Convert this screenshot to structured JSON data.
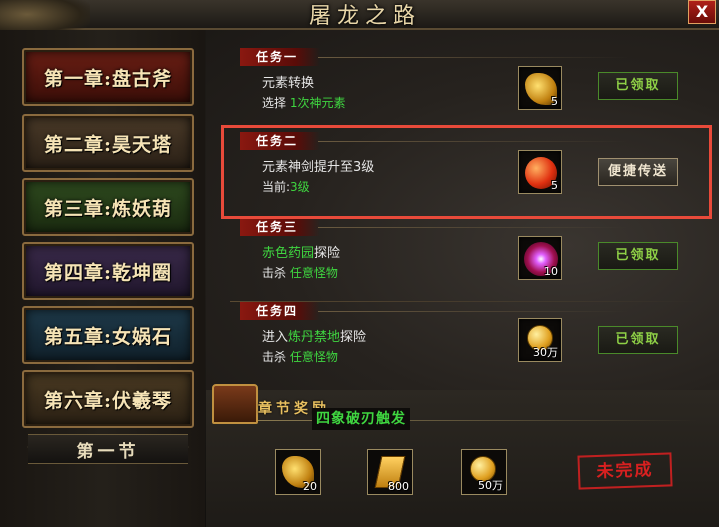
{
  "window": {
    "title": "屠龙之路",
    "close_label": "X"
  },
  "chapters": [
    {
      "label": "第一章:盘古斧"
    },
    {
      "label": "第二章:昊天塔"
    },
    {
      "label": "第三章:炼妖葫"
    },
    {
      "label": "第四章:乾坤圈"
    },
    {
      "label": "第五章:女娲石"
    },
    {
      "label": "第六章:伏羲琴"
    }
  ],
  "section_label": "第一节",
  "tasks": [
    {
      "tag": "任务一",
      "desc_pre": "元素转换",
      "desc_hl": "",
      "desc_post": "",
      "sub_label": "选择",
      "sub_value": "1次神元素",
      "reward_count": "5",
      "reward_icon": "gold-dragon-item-icon",
      "button": "已领取"
    },
    {
      "tag": "任务二",
      "desc_pre": "元素神剑提升至3级",
      "desc_hl": "",
      "desc_post": "",
      "sub_label": "当前:",
      "sub_value": "3级",
      "reward_count": "5",
      "reward_icon": "red-orb-item-icon",
      "button": "便捷传送"
    },
    {
      "tag": "任务三",
      "desc_pre": "",
      "desc_hl": "赤色药园",
      "desc_post": "探险",
      "sub_label": "击杀",
      "sub_value": "任意怪物",
      "reward_count": "10",
      "reward_icon": "purple-gem-item-icon",
      "button": "已领取"
    },
    {
      "tag": "任务四",
      "desc_pre": "进入",
      "desc_hl": "炼丹禁地",
      "desc_post": "探险",
      "sub_label": "击杀",
      "sub_value": "任意怪物",
      "reward_count": "30万",
      "reward_icon": "gold-coin-icon",
      "button": "已领取"
    }
  ],
  "chapter_reward": {
    "title": "章节奖励",
    "item_name": "四象破刃触发",
    "items": [
      {
        "count": "20",
        "icon": "gold-dragon-item-icon"
      },
      {
        "count": "800",
        "icon": "ticket-icon"
      },
      {
        "count": "50万",
        "icon": "gold-coin-icon"
      }
    ],
    "status": "未完成"
  },
  "colors": {
    "accent_red": "#e84a3a",
    "green_text": "#3fd640",
    "gold": "#e8c060"
  }
}
